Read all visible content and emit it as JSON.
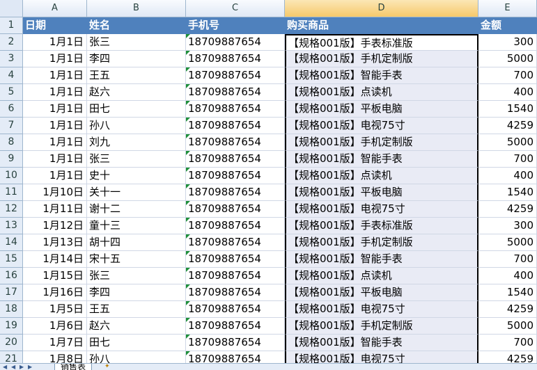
{
  "columns": [
    "A",
    "B",
    "C",
    "D",
    "E"
  ],
  "header": {
    "row_num": "1",
    "a": "日期",
    "b": "姓名",
    "c": "手机号",
    "d": "购买商品",
    "e": "金额"
  },
  "rows": [
    {
      "n": "2",
      "date": "1月1日",
      "name": "张三",
      "phone": "18709887654",
      "product": "【规格001版】手表标准版",
      "amount": "300"
    },
    {
      "n": "3",
      "date": "1月1日",
      "name": "李四",
      "phone": "18709887654",
      "product": "【规格001版】手机定制版",
      "amount": "5000"
    },
    {
      "n": "4",
      "date": "1月1日",
      "name": "王五",
      "phone": "18709887654",
      "product": "【规格001版】智能手表",
      "amount": "700"
    },
    {
      "n": "5",
      "date": "1月1日",
      "name": "赵六",
      "phone": "18709887654",
      "product": "【规格001版】点读机",
      "amount": "400"
    },
    {
      "n": "6",
      "date": "1月1日",
      "name": "田七",
      "phone": "18709887654",
      "product": "【规格001版】平板电脑",
      "amount": "1540"
    },
    {
      "n": "7",
      "date": "1月1日",
      "name": "孙八",
      "phone": "18709887654",
      "product": "【规格001版】电视75寸",
      "amount": "4259"
    },
    {
      "n": "8",
      "date": "1月1日",
      "name": "刘九",
      "phone": "18709887654",
      "product": "【规格001版】手机定制版",
      "amount": "5000"
    },
    {
      "n": "9",
      "date": "1月1日",
      "name": "张三",
      "phone": "18709887654",
      "product": "【规格001版】智能手表",
      "amount": "700"
    },
    {
      "n": "10",
      "date": "1月1日",
      "name": "史十",
      "phone": "18709887654",
      "product": "【规格001版】点读机",
      "amount": "400"
    },
    {
      "n": "11",
      "date": "1月10日",
      "name": "关十一",
      "phone": "18709887654",
      "product": "【规格001版】平板电脑",
      "amount": "1540"
    },
    {
      "n": "12",
      "date": "1月11日",
      "name": "谢十二",
      "phone": "18709887654",
      "product": "【规格001版】电视75寸",
      "amount": "4259"
    },
    {
      "n": "13",
      "date": "1月12日",
      "name": "童十三",
      "phone": "18709887654",
      "product": "【规格001版】手表标准版",
      "amount": "300"
    },
    {
      "n": "14",
      "date": "1月13日",
      "name": "胡十四",
      "phone": "18709887654",
      "product": "【规格001版】手机定制版",
      "amount": "5000"
    },
    {
      "n": "15",
      "date": "1月14日",
      "name": "宋十五",
      "phone": "18709887654",
      "product": "【规格001版】智能手表",
      "amount": "700"
    },
    {
      "n": "16",
      "date": "1月15日",
      "name": "张三",
      "phone": "18709887654",
      "product": "【规格001版】点读机",
      "amount": "400"
    },
    {
      "n": "17",
      "date": "1月16日",
      "name": "李四",
      "phone": "18709887654",
      "product": "【规格001版】平板电脑",
      "amount": "1540"
    },
    {
      "n": "18",
      "date": "1月5日",
      "name": "王五",
      "phone": "18709887654",
      "product": "【规格001版】电视75寸",
      "amount": "4259"
    },
    {
      "n": "19",
      "date": "1月6日",
      "name": "赵六",
      "phone": "18709887654",
      "product": "【规格001版】手机定制版",
      "amount": "5000"
    },
    {
      "n": "20",
      "date": "1月7日",
      "name": "田七",
      "phone": "18709887654",
      "product": "【规格001版】智能手表",
      "amount": "700"
    },
    {
      "n": "21",
      "date": "1月8日",
      "name": "孙八",
      "phone": "18709887654",
      "product": "【规格001版】电视75寸",
      "amount": "4259"
    }
  ],
  "selected_column": "D",
  "sheet_tab": "销售表",
  "colors": {
    "header_fill": "#4f81bd",
    "selection_fill": "#e9ebf5",
    "error_triangle": "#1e8f3a"
  }
}
